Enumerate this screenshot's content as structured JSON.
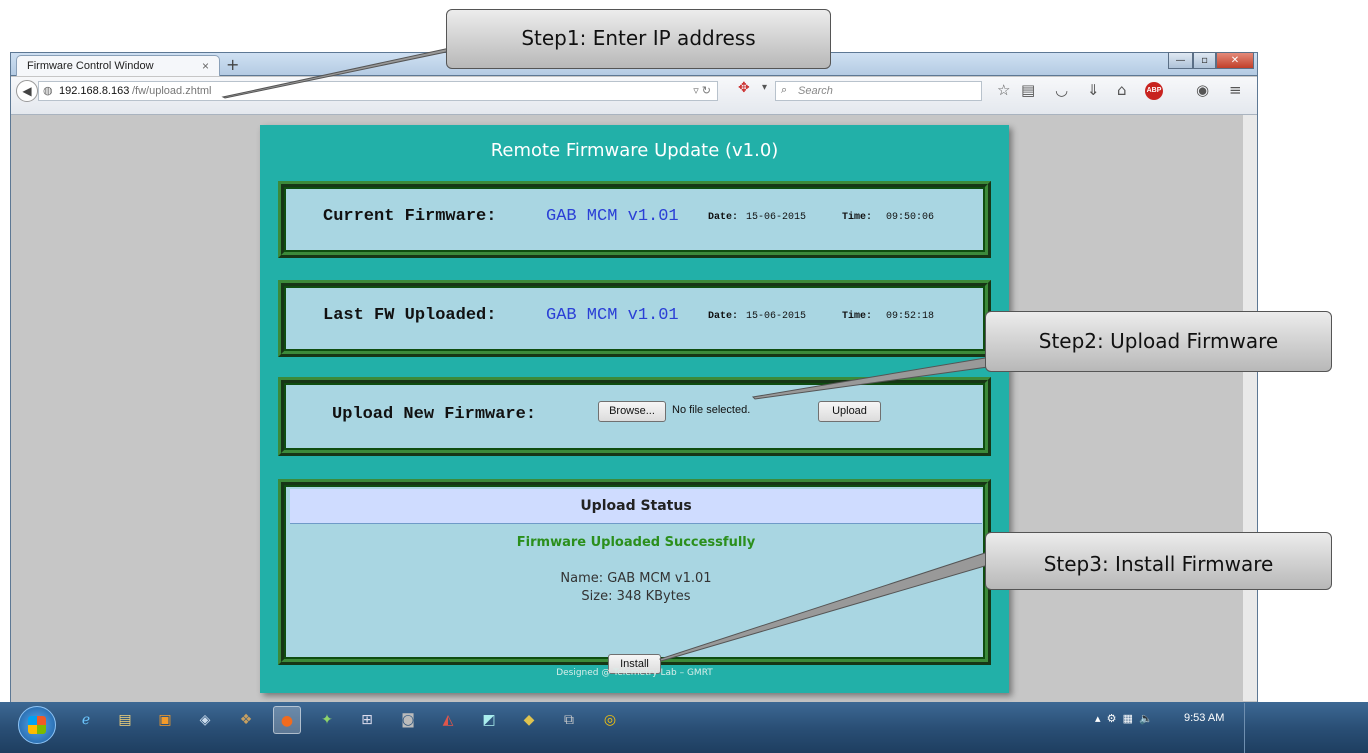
{
  "browser": {
    "tab_title": "Firmware Control Window",
    "tab_close": "×",
    "new_tab": "+",
    "url_host": "192.168.8.163",
    "url_path": "/fw/upload.zhtml",
    "search_placeholder": "Search",
    "toolbar_icons": [
      "star-icon",
      "reading-list-icon",
      "pocket-icon",
      "download-icon",
      "home-icon",
      "adblock-icon",
      "chat-icon",
      "menu-icon"
    ],
    "abp_label": "ABP"
  },
  "page": {
    "title": "Remote Firmware Update (v1.0)",
    "current": {
      "label": "Current Firmware:",
      "name": "GAB MCM v1.01",
      "date_label": "Date:",
      "date": "15-06-2015",
      "time_label": "Time:",
      "time": "09:50:06"
    },
    "last": {
      "label": "Last FW Uploaded:",
      "name": "GAB MCM v1.01",
      "date_label": "Date:",
      "date": "15-06-2015",
      "time_label": "Time:",
      "time": "09:52:18"
    },
    "upload": {
      "label": "Upload New Firmware:",
      "browse": "Browse...",
      "no_file": "No file selected.",
      "upload_button": "Upload"
    },
    "status": {
      "heading": "Upload Status",
      "message": "Firmware Uploaded Successfully",
      "name_line": "Name: GAB MCM v1.01",
      "size_line": "Size: 348 KBytes",
      "install_button": "Install"
    },
    "footer": "Designed @ Telemetry Lab – GMRT"
  },
  "callouts": {
    "step1": "Step1:  Enter IP address",
    "step2": "Step2:  Upload Firmware",
    "step3": "Step3:  Install Firmware"
  },
  "taskbar": {
    "clock": "9:53 AM",
    "apps": [
      "ie-icon",
      "explorer-icon",
      "media-player-icon",
      "app-icon",
      "box-icon",
      "firefox-icon",
      "app2-icon",
      "network-icon",
      "audio-icon",
      "matlab-icon",
      "app3-icon",
      "app4-icon",
      "remote-icon",
      "chrome-icon"
    ]
  },
  "colors": {
    "panel": "#22b0a8",
    "box": "#a9d6e2",
    "fw_name": "#2a3fd6",
    "success": "#2b8f1c"
  }
}
